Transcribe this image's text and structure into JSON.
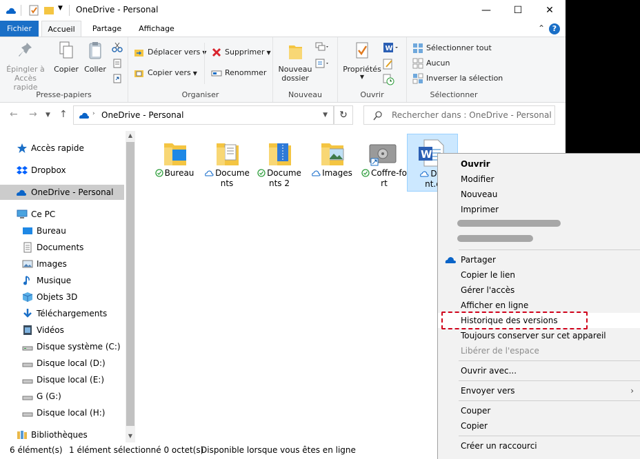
{
  "window": {
    "title": "OneDrive - Personal",
    "controls": {
      "minimize": "—",
      "maximize": "☐",
      "close": "✕"
    }
  },
  "ribbon_tabs": [
    {
      "label": "Fichier"
    },
    {
      "label": "Accueil"
    },
    {
      "label": "Partage"
    },
    {
      "label": "Affichage"
    }
  ],
  "help_label": "?",
  "ribbon": {
    "presse_papiers": {
      "label": "Presse-papiers",
      "pin": "Épingler à\nAccès rapide",
      "pin_line1": "Épingler à",
      "pin_line2": "Accès rapide",
      "copy": "Copier",
      "paste": "Coller"
    },
    "organiser": {
      "label": "Organiser",
      "move_to": "Déplacer vers",
      "copy_to": "Copier vers",
      "delete": "Supprimer",
      "rename": "Renommer"
    },
    "nouveau": {
      "label": "Nouveau",
      "new_folder_line1": "Nouveau",
      "new_folder_line2": "dossier"
    },
    "ouvrir": {
      "label": "Ouvrir",
      "properties": "Propriétés"
    },
    "selectionner": {
      "label": "Sélectionner",
      "select_all": "Sélectionner tout",
      "none": "Aucun",
      "invert": "Inverser la sélection"
    }
  },
  "address_bar": {
    "path": "OneDrive - Personal",
    "search_placeholder": "Rechercher dans : OneDrive - Personal"
  },
  "sidebar": {
    "items": [
      {
        "label": "Accès rapide",
        "icon": "star-icon"
      },
      {
        "label": "Dropbox",
        "icon": "dropbox-icon"
      },
      {
        "label": "OneDrive - Personal",
        "icon": "cloud-icon",
        "selected": true
      },
      {
        "label": "Ce PC",
        "icon": "pc-icon"
      },
      {
        "label": "Bureau",
        "icon": "desktop-icon"
      },
      {
        "label": "Documents",
        "icon": "document-icon"
      },
      {
        "label": "Images",
        "icon": "image-icon"
      },
      {
        "label": "Musique",
        "icon": "music-icon"
      },
      {
        "label": "Objets 3D",
        "icon": "cube-icon"
      },
      {
        "label": "Téléchargements",
        "icon": "download-icon"
      },
      {
        "label": "Vidéos",
        "icon": "video-icon"
      },
      {
        "label": "Disque système (C:)",
        "icon": "drive-icon"
      },
      {
        "label": "Disque local (D:)",
        "icon": "drive-icon"
      },
      {
        "label": "Disque local (E:)",
        "icon": "drive-icon"
      },
      {
        "label": "G (G:)",
        "icon": "drive-icon"
      },
      {
        "label": "Disque local (H:)",
        "icon": "drive-icon"
      },
      {
        "label": "Bibliothèques",
        "icon": "library-icon"
      }
    ]
  },
  "files": [
    {
      "line1": "Bureau",
      "line2": "",
      "status": "synced",
      "icon": "folder-desktop-icon"
    },
    {
      "line1": "Docume",
      "line2": "nts",
      "status": "cloud",
      "icon": "folder-documents-icon"
    },
    {
      "line1": "Docume",
      "line2": "nts 2",
      "status": "synced",
      "icon": "folder-zip-icon"
    },
    {
      "line1": "Images",
      "line2": "",
      "status": "cloud",
      "icon": "folder-images-icon"
    },
    {
      "line1": "Coffre-fo",
      "line2": "rt",
      "status": "synced",
      "icon": "vault-icon"
    },
    {
      "line1": "Doc",
      "line2": "nt.d",
      "status": "cloud",
      "icon": "word-document-icon",
      "selected": true
    }
  ],
  "status_bar": {
    "count": "6 élément(s)",
    "selection": "1 élément sélectionné  0 octet(s)",
    "availability": "Disponible lorsque vous êtes en ligne"
  },
  "context_menu": {
    "items": [
      {
        "label": "Ouvrir",
        "bold": true
      },
      {
        "label": "Modifier"
      },
      {
        "label": "Nouveau"
      },
      {
        "label": "Imprimer"
      },
      {
        "label": "Partager",
        "icon": "onedrive-cloud-icon"
      },
      {
        "label": "Copier le lien"
      },
      {
        "label": "Gérer l'accès"
      },
      {
        "label": "Afficher en ligne"
      },
      {
        "label": "Historique des versions",
        "highlighted": true
      },
      {
        "label": "Toujours conserver sur cet appareil"
      },
      {
        "label": "Libérer de l'espace",
        "disabled": true
      },
      {
        "label": "Ouvrir avec..."
      },
      {
        "label": "Envoyer vers",
        "submenu": true
      },
      {
        "label": "Couper"
      },
      {
        "label": "Copier"
      },
      {
        "label": "Créer un raccourci"
      }
    ],
    "submenu_arrow": "›"
  },
  "colors": {
    "accent": "#1a6fc7",
    "selection": "#cce8ff",
    "folder": "#f4c542",
    "sync_green": "#2e9e3c",
    "annotation_red": "#d0021b"
  }
}
